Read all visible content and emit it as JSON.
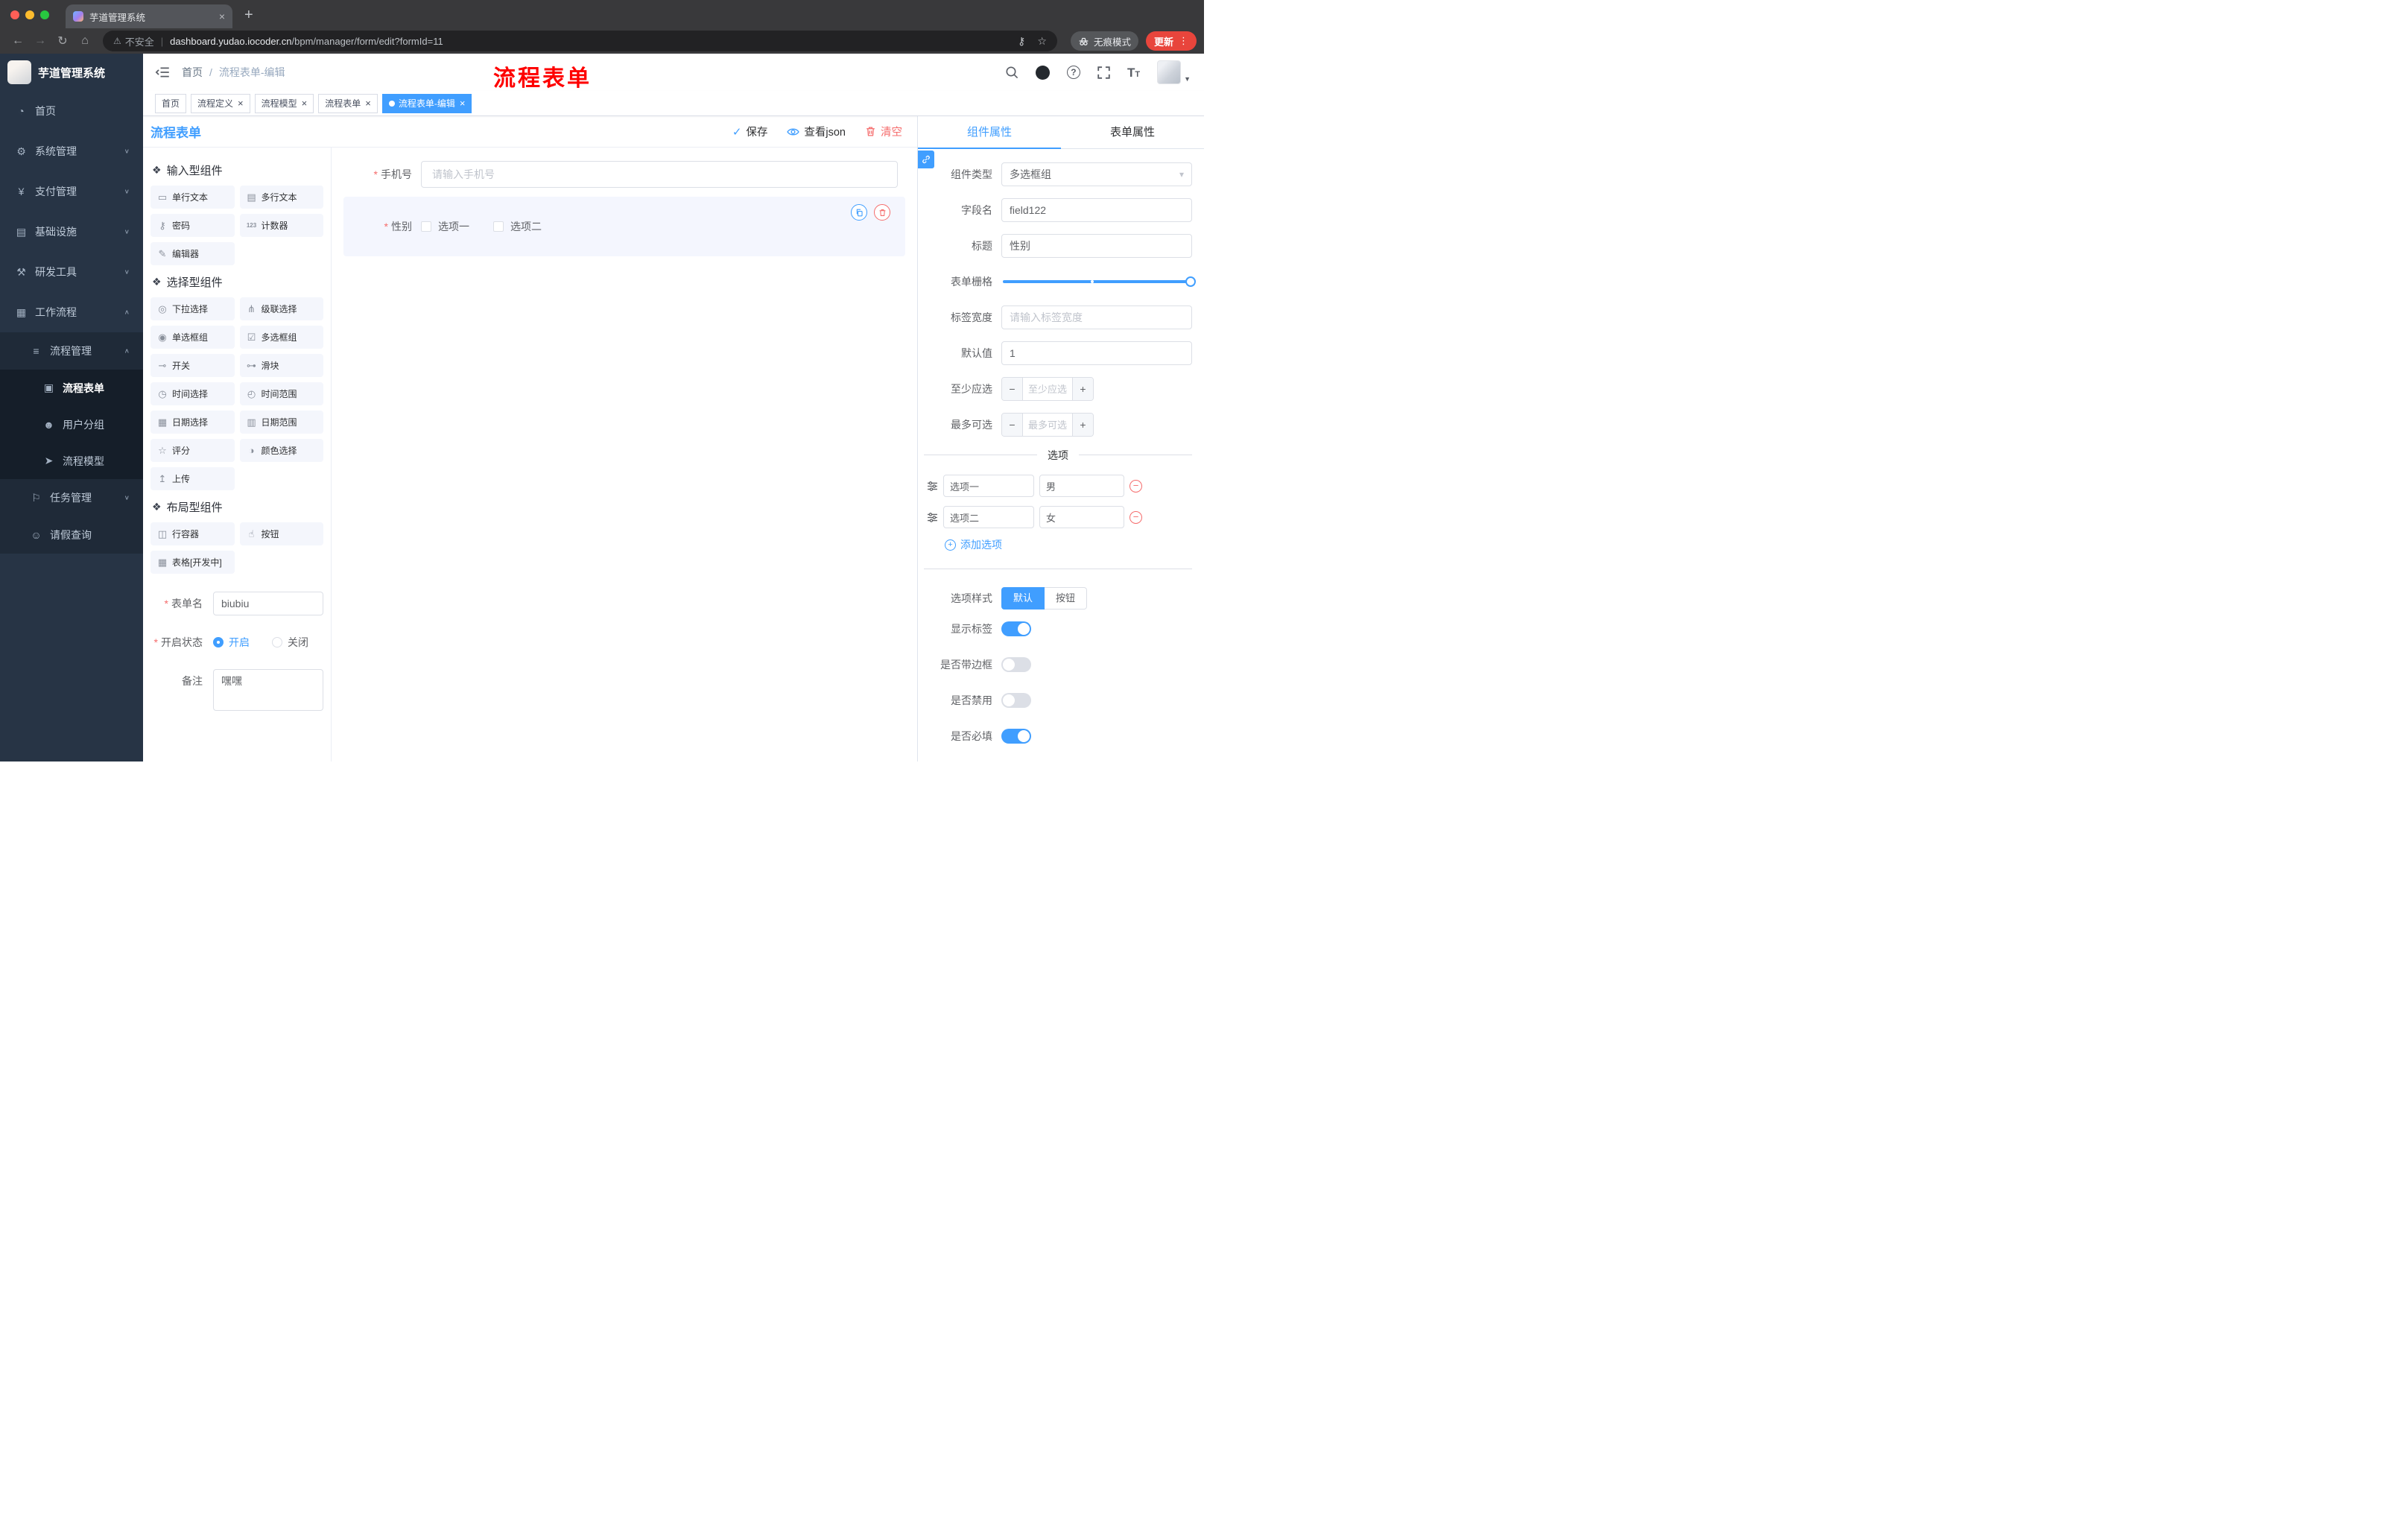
{
  "browser": {
    "traffic_lights": [
      "#ff5f57",
      "#febc2e",
      "#28c840"
    ],
    "tab": {
      "title": "芋道管理系统"
    },
    "toolbar": {
      "security_text": "不安全",
      "url_domain": "dashboard.yudao.iocoder.cn",
      "url_path": "/bpm/manager/form/edit?formId=11",
      "incognito_label": "无痕模式",
      "update_label": "更新"
    }
  },
  "sidebar": {
    "app_title": "芋道管理系统",
    "items": [
      {
        "id": "home",
        "label": "首页",
        "icon": "dashboard-icon",
        "depth": 1
      },
      {
        "id": "system",
        "label": "系统管理",
        "icon": "system-icon",
        "depth": 1,
        "chevron": "down"
      },
      {
        "id": "payment",
        "label": "支付管理",
        "icon": "payment-icon",
        "depth": 1,
        "chevron": "down"
      },
      {
        "id": "infrastructure",
        "label": "基础设施",
        "icon": "infrastructure-icon",
        "depth": 1,
        "chevron": "down"
      },
      {
        "id": "devtools",
        "label": "研发工具",
        "icon": "devtools-icon",
        "depth": 1,
        "chevron": "down"
      },
      {
        "id": "workflow",
        "label": "工作流程",
        "icon": "workflow-icon",
        "depth": 1,
        "chevron": "up"
      },
      {
        "id": "process-management",
        "label": "流程管理",
        "icon": "process-management-icon",
        "depth": 2,
        "chevron": "up"
      },
      {
        "id": "process-form",
        "label": "流程表单",
        "icon": "process-form-icon",
        "depth": 3,
        "active": true
      },
      {
        "id": "user-group",
        "label": "用户分组",
        "icon": "user-group-icon",
        "depth": 3
      },
      {
        "id": "process-model",
        "label": "流程模型",
        "icon": "process-model-icon",
        "depth": 3
      },
      {
        "id": "task-management",
        "label": "任务管理",
        "icon": "task-management-icon",
        "depth": 2,
        "chevron": "down"
      },
      {
        "id": "leave-query",
        "label": "请假查询",
        "icon": "leave-query-icon",
        "depth": 2
      }
    ]
  },
  "header": {
    "breadcrumb": [
      "首页",
      "流程表单-编辑"
    ],
    "breadcrumb_separator": "/",
    "overlay_title": "流程表单",
    "right_icons": [
      "search-icon",
      "github-icon",
      "help-icon",
      "fullscreen-icon",
      "font-size-icon",
      "avatar"
    ]
  },
  "tags": [
    {
      "label": "首页",
      "closable": false,
      "active": false
    },
    {
      "label": "流程定义",
      "closable": true,
      "active": false
    },
    {
      "label": "流程模型",
      "closable": true,
      "active": false
    },
    {
      "label": "流程表单",
      "closable": true,
      "active": false
    },
    {
      "label": "流程表单-编辑",
      "closable": true,
      "active": true
    }
  ],
  "designer": {
    "panel_title": "流程表单",
    "actions": {
      "save": "保存",
      "view_json": "查看json",
      "clear": "清空"
    },
    "palette": [
      {
        "title": "输入型组件",
        "items": [
          {
            "label": "单行文本",
            "icon": "single-line-text-icon"
          },
          {
            "label": "多行文本",
            "icon": "multi-line-text-icon"
          },
          {
            "label": "密码",
            "icon": "password-icon"
          },
          {
            "label": "计数器",
            "icon": "counter-icon"
          },
          {
            "label": "编辑器",
            "icon": "editor-icon"
          }
        ]
      },
      {
        "title": "选择型组件",
        "items": [
          {
            "label": "下拉选择",
            "icon": "select-icon"
          },
          {
            "label": "级联选择",
            "icon": "cascader-icon"
          },
          {
            "label": "单选框组",
            "icon": "radio-group-icon"
          },
          {
            "label": "多选框组",
            "icon": "checkbox-group-icon"
          },
          {
            "label": "开关",
            "icon": "switch-icon"
          },
          {
            "label": "滑块",
            "icon": "slider-icon"
          },
          {
            "label": "时间选择",
            "icon": "time-icon"
          },
          {
            "label": "时间范围",
            "icon": "time-range-icon"
          },
          {
            "label": "日期选择",
            "icon": "date-icon"
          },
          {
            "label": "日期范围",
            "icon": "date-range-icon"
          },
          {
            "label": "评分",
            "icon": "rate-icon"
          },
          {
            "label": "颜色选择",
            "icon": "color-icon"
          },
          {
            "label": "上传",
            "icon": "upload-icon"
          }
        ]
      },
      {
        "title": "布局型组件",
        "items": [
          {
            "label": "行容器",
            "icon": "row-icon"
          },
          {
            "label": "按钮",
            "icon": "button-icon"
          },
          {
            "label": "表格[开发中]",
            "icon": "table-icon"
          }
        ]
      }
    ],
    "form_meta": {
      "name_label": "表单名",
      "name_value": "biubiu",
      "status_label": "开启状态",
      "status_on": "开启",
      "status_off": "关闭",
      "status_value": "开启",
      "remark_label": "备注",
      "remark_value": "嘿嘿"
    },
    "canvas": {
      "fields": [
        {
          "type": "input",
          "label": "手机号",
          "required": true,
          "placeholder": "请输入手机号",
          "selected": false
        },
        {
          "type": "checkbox-group",
          "label": "性别",
          "required": true,
          "options": [
            "选项一",
            "选项二"
          ],
          "selected": true
        }
      ]
    }
  },
  "properties": {
    "tabs": [
      {
        "label": "组件属性",
        "active": true
      },
      {
        "label": "表单属性",
        "active": false
      }
    ],
    "fields": {
      "component_type": {
        "label": "组件类型",
        "value": "多选框组"
      },
      "field_name": {
        "label": "字段名",
        "value": "field122"
      },
      "title": {
        "label": "标题",
        "value": "性别"
      },
      "form_grid": {
        "label": "表单栅格"
      },
      "label_width": {
        "label": "标签宽度",
        "placeholder": "请输入标签宽度"
      },
      "default_value": {
        "label": "默认值",
        "value": "1"
      },
      "min_select": {
        "label": "至少应选",
        "placeholder": "至少应选"
      },
      "max_select": {
        "label": "最多可选",
        "placeholder": "最多可选"
      }
    },
    "stepper": {
      "minus": "−",
      "plus": "+"
    },
    "options_divider": "选项",
    "options": [
      {
        "label": "选项一",
        "value": "男"
      },
      {
        "label": "选项二",
        "value": "女"
      }
    ],
    "add_option_label": "添加选项",
    "option_style": {
      "label": "选项样式",
      "choices": [
        "默认",
        "按钮"
      ],
      "active": "默认"
    },
    "toggles": [
      {
        "label": "显示标签",
        "on": true
      },
      {
        "label": "是否带边框",
        "on": false
      },
      {
        "label": "是否禁用",
        "on": false
      },
      {
        "label": "是否必填",
        "on": true
      }
    ]
  },
  "colors": {
    "primary": "#409eff",
    "danger": "#f56c6c",
    "active_tag_bg": "#409eff",
    "update_button_bg": "#e8453c",
    "sidebar_bg": "#273445"
  }
}
